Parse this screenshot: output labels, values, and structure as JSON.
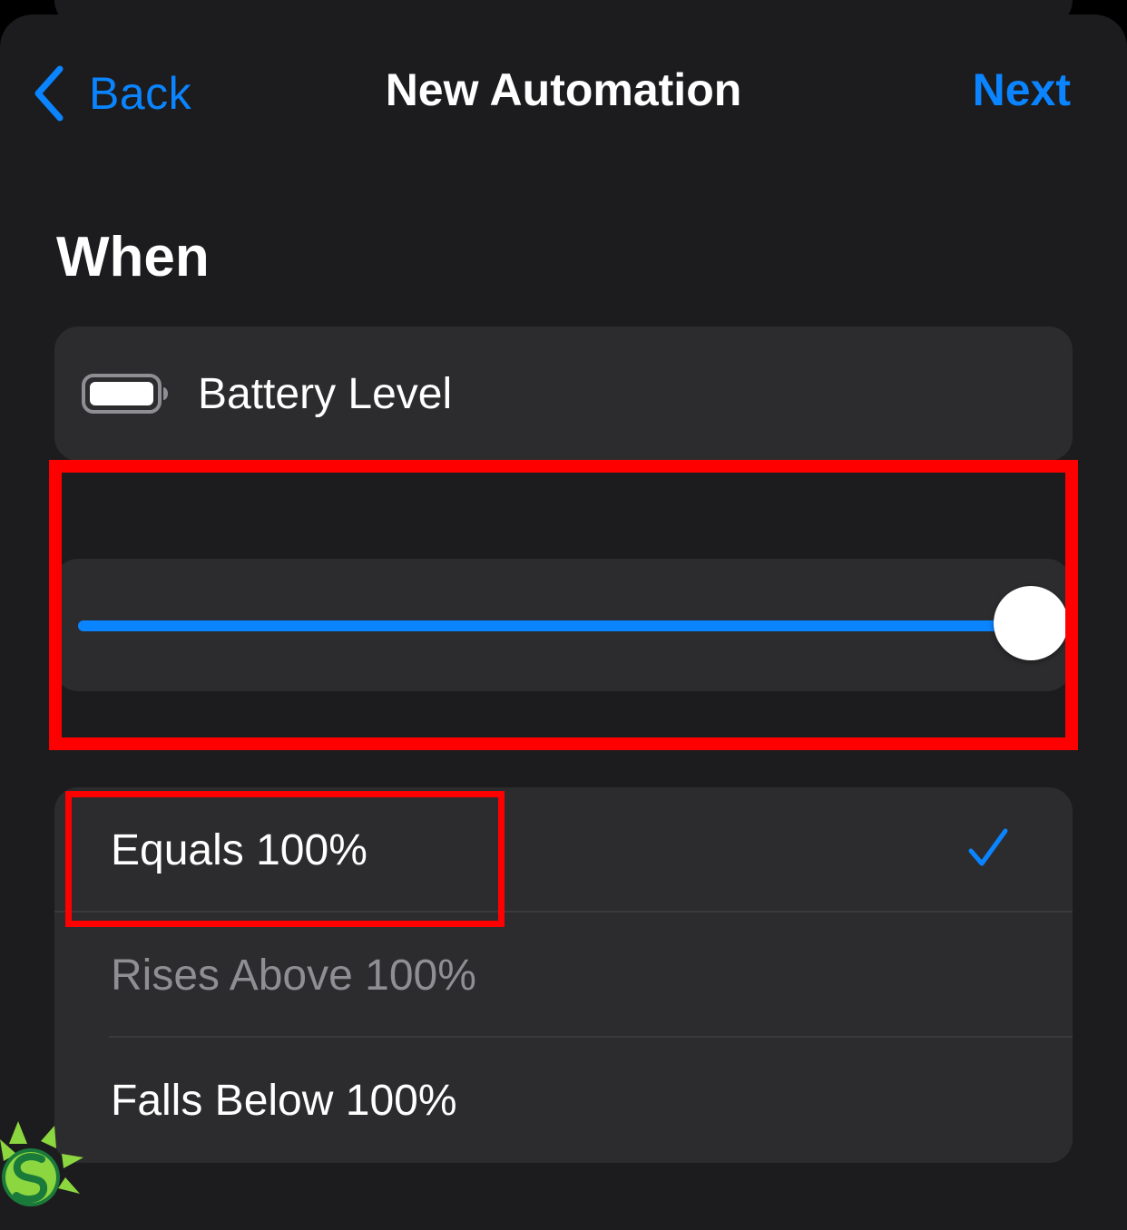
{
  "nav": {
    "back_label": "Back",
    "title": "New Automation",
    "next_label": "Next"
  },
  "section": {
    "heading": "When"
  },
  "trigger": {
    "icon": "battery-icon",
    "label": "Battery Level"
  },
  "slider": {
    "value_percent": 100
  },
  "options": [
    {
      "label": "Equals 100%",
      "selected": true,
      "enabled": true
    },
    {
      "label": "Rises Above 100%",
      "selected": false,
      "enabled": false
    },
    {
      "label": "Falls Below 100%",
      "selected": false,
      "enabled": true
    }
  ],
  "colors": {
    "accent": "#0a84ff",
    "background": "#1c1c1e",
    "card": "#2c2c2e",
    "highlight": "#ff0000"
  }
}
